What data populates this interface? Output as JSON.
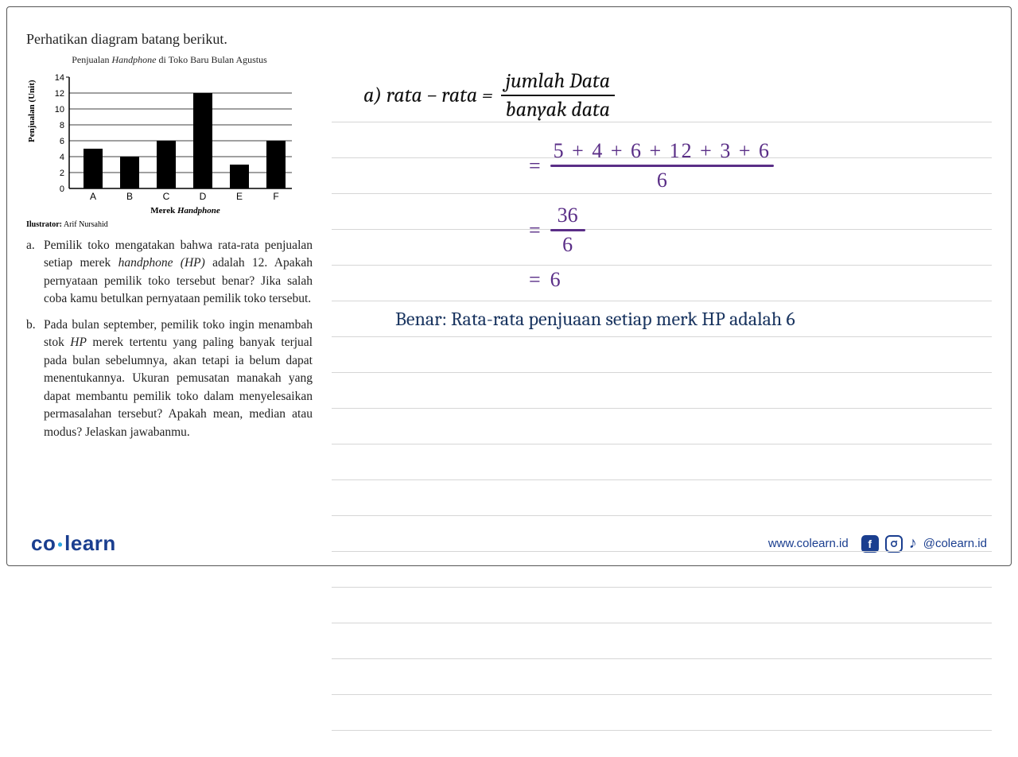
{
  "intro": "Perhatikan diagram batang berikut.",
  "chart_data": {
    "type": "bar",
    "title": "Penjualan Handphone di Toko Baru Bulan Agustus",
    "categories": [
      "A",
      "B",
      "C",
      "D",
      "E",
      "F"
    ],
    "values": [
      5,
      4,
      6,
      12,
      3,
      6
    ],
    "xlabel": "Merek Handphone",
    "ylabel": "Penjualan (Unit)",
    "ylim": [
      0,
      14
    ],
    "ytick_step": 2
  },
  "illustrator_label": "Ilustrator:",
  "illustrator_name": "Arif Nursahid",
  "questions": {
    "a": {
      "letter": "a.",
      "text": "Pemilik toko mengatakan bahwa rata-rata penjualan setiap merek handphone (HP) adalah 12. Apakah pernyataan pemilik toko tersebut benar? Jika salah coba kamu betulkan pernyataan pemilik toko tersebut."
    },
    "b": {
      "letter": "b.",
      "text": "Pada bulan september, pemilik toko ingin menambah stok HP merek tertentu yang paling banyak terjual pada bulan sebelumnya, akan tetapi ia belum dapat menentukannya. Ukuran pemusatan manakah yang dapat membantu pemilik toko dalam menyelesaikan permasalahan tersebut? Apakah mean, median atau modus? Jelaskan jawabanmu."
    }
  },
  "solution": {
    "lhs": "a) rata − rata =",
    "frac_num": "jumlah Data",
    "frac_den": "banyak data",
    "step1_num": "5 + 4 + 6 + 12 + 3 + 6",
    "step1_den": "6",
    "step2_num": "36",
    "step2_den": "6",
    "step3": "6",
    "conclusion": "Benar: Rata-rata penjuaan setiap merk HP adalah 6"
  },
  "footer": {
    "logo_co": "co",
    "logo_learn": "learn",
    "url": "www.colearn.id",
    "handle": "@colearn.id"
  }
}
